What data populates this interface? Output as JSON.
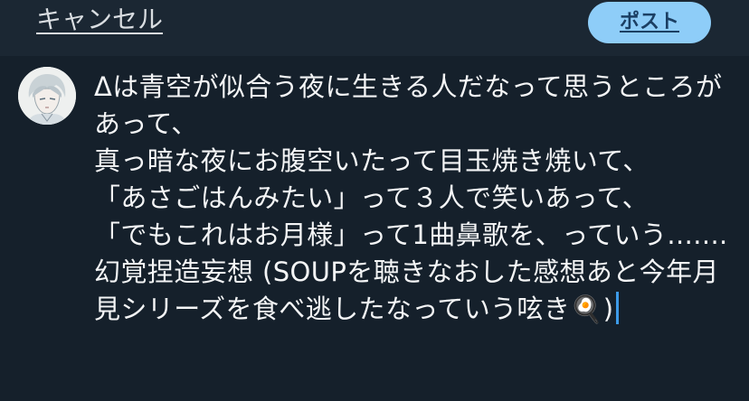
{
  "header": {
    "cancel_label": "キャンセル",
    "post_label": "ポスト"
  },
  "composer": {
    "avatar_icon": "user-avatar-anime-character",
    "text": "Δは青空が似合う夜に生きる人だなって思うところがあって、\n真っ暗な夜にお腹空いたって目玉焼き焼いて、\n「あさごはんみたい」って３人で笑いあって、\n「でもこれはお月様」って1曲鼻歌を、っていう.......幻覚捏造妄想 (SOUPを聴きなおした感想あと今年月見シリーズを食べ逃したなっていう呟き🍳)"
  },
  "colors": {
    "background": "#15202b",
    "header_background": "#1b2733",
    "accent_button": "#8ecdf8",
    "cursor": "#3d9be9",
    "text": "#f4f5f6"
  }
}
